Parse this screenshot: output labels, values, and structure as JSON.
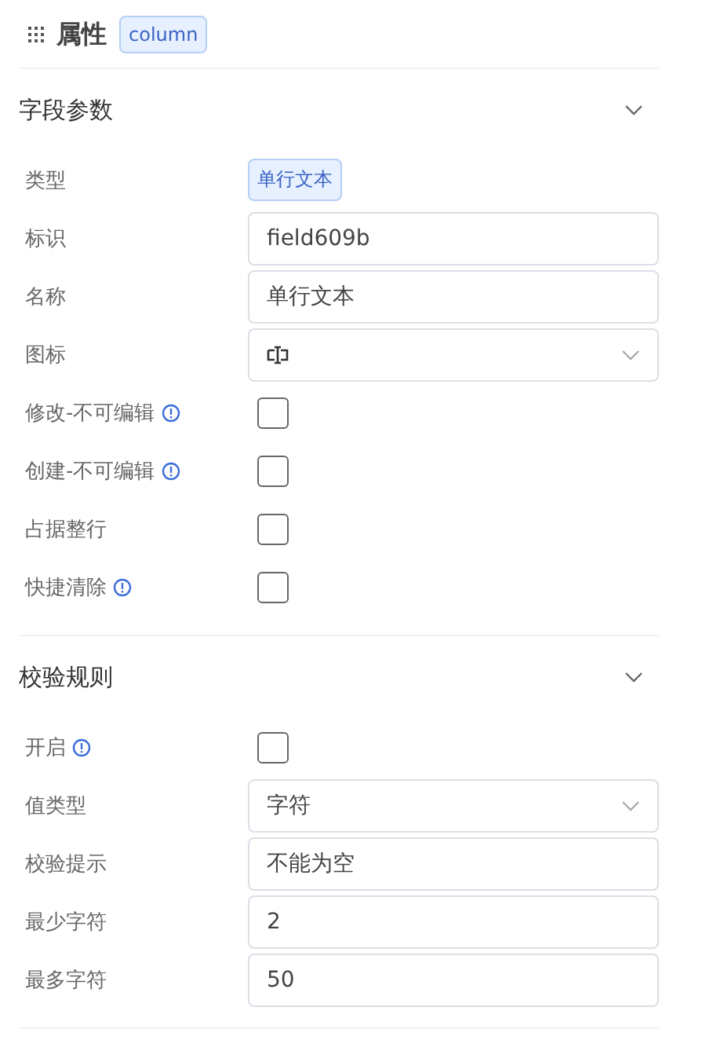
{
  "header": {
    "title": "属性",
    "tag": "column"
  },
  "sections": [
    {
      "title": "字段参数",
      "expanded": true,
      "rows": [
        {
          "label": "类型",
          "kind": "tag",
          "value": "单行文本"
        },
        {
          "label": "标识",
          "kind": "input",
          "value": "field609b"
        },
        {
          "label": "名称",
          "kind": "input",
          "value": "单行文本"
        },
        {
          "label": "图标",
          "kind": "icon-select"
        },
        {
          "label": "修改-不可编辑",
          "kind": "checkbox",
          "info": true,
          "checked": false
        },
        {
          "label": "创建-不可编辑",
          "kind": "checkbox",
          "info": true,
          "checked": false
        },
        {
          "label": "占据整行",
          "kind": "checkbox",
          "info": false,
          "checked": false
        },
        {
          "label": "快捷清除",
          "kind": "checkbox",
          "info": true,
          "checked": false
        }
      ]
    },
    {
      "title": "校验规则",
      "expanded": true,
      "rows": [
        {
          "label": "开启",
          "kind": "checkbox",
          "info": true,
          "checked": false
        },
        {
          "label": "值类型",
          "kind": "select",
          "value": "字符"
        },
        {
          "label": "校验提示",
          "kind": "input",
          "value": "不能为空"
        },
        {
          "label": "最少字符",
          "kind": "input",
          "value": "2"
        },
        {
          "label": "最多字符",
          "kind": "input",
          "value": "50"
        }
      ]
    }
  ]
}
